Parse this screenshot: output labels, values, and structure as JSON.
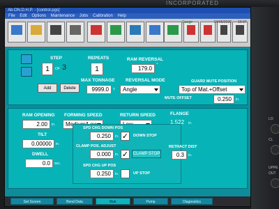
{
  "bezel": {
    "brand": "INCORPORATED"
  },
  "titlebar": {
    "text": "Ab.ON.D.H.P. - [control.pgs]"
  },
  "menu": [
    "File",
    "Edit",
    "Options",
    "Maintenance",
    "Jobs",
    "Calibration",
    "Help"
  ],
  "toolbar": {
    "buttons": [
      {
        "icon": "document-icon",
        "color": "#3a78c9"
      },
      {
        "icon": "folder-icon",
        "color": "#d9a93a"
      },
      {
        "icon": "save-disk-icon",
        "color": "#444"
      },
      {
        "icon": "calculator-icon",
        "color": "#666"
      },
      {
        "icon": "tool-icon",
        "color": "#c33"
      },
      {
        "icon": "gauge-icon",
        "color": "#2a9a4a"
      },
      {
        "icon": "cycle-icon",
        "color": "#2a7ab8"
      },
      {
        "icon": "wrench-icon",
        "color": "#3a78c9"
      },
      {
        "icon": "settings-icon",
        "color": "#777"
      },
      {
        "icon": "graph-icon",
        "color": "#2a9a4a"
      },
      {
        "icon": "curve-icon",
        "color": "#c33"
      },
      {
        "icon": "crossed-curve-icon",
        "color": "#c33"
      },
      {
        "icon": "bend-icon",
        "color": "#3a78c9"
      },
      {
        "icon": "person-icon",
        "color": "#444"
      },
      {
        "icon": "hand-icon",
        "color": "#444"
      }
    ],
    "status": "Gauge",
    "date": "04/06/2020",
    "time": "10:37"
  },
  "step": {
    "label": "STEP",
    "value": "1",
    "of_label": "OF",
    "total": "3",
    "add_label": "Add",
    "delete_label": "Delete"
  },
  "repeats": {
    "label": "REPEATS",
    "value": "1"
  },
  "ram_reversal": {
    "label": "RAM REVERSAL",
    "value": "179.0",
    "unit": "°"
  },
  "max_tonnage": {
    "label": "MAX TONNAGE",
    "value": "9999.0",
    "unit": "T"
  },
  "reversal_mode": {
    "label": "REVERSAL MODE",
    "value": "Angle"
  },
  "guard_mute": {
    "label": "GUARD MUTE POSITION",
    "value": "Top of Mat.+Offset",
    "offset_label": "MUTE OFFSET",
    "offset_value": "0.250",
    "offset_unit": "in."
  },
  "ram_opening": {
    "label": "RAM OPENING",
    "value": "2.00",
    "unit": "in."
  },
  "forming_speed": {
    "label": "FORMING SPEED",
    "value": "Medium/Low"
  },
  "return_speed": {
    "label": "RETURN SPEED",
    "value": "Low"
  },
  "flange": {
    "label": "FLANGE",
    "value": "1.522",
    "unit": "in."
  },
  "tilt": {
    "label": "TILT",
    "value": "0.00000",
    "unit": "in."
  },
  "dwell": {
    "label": "DWELL",
    "value": "0.0",
    "unit": "sec."
  },
  "spd_chg_down": {
    "label": "SPD CHG DOWN POS",
    "value": "0.250",
    "unit": "in.",
    "checked": true,
    "check_label": "DOWN STOP"
  },
  "clamp_pos_adjust": {
    "label": "CLAMP POS. ADJUST",
    "value": "0.000",
    "unit": "in.",
    "checked": true,
    "button_label": "CLAMP STOP"
  },
  "retract_dist": {
    "label": "RETRACT DIST",
    "value": "0.3",
    "unit": "in."
  },
  "spd_chg_up": {
    "label": "SPD CHG UP POS",
    "value": "0.250",
    "unit": "in.",
    "checked": false,
    "check_label": "UP STOP"
  },
  "tabs": [
    "Set Screen",
    "Bend Data",
    "Run",
    "Pump",
    "Diagnostics"
  ],
  "side_labels": [
    "LO",
    "CL",
    "UPPE",
    "OUT"
  ]
}
